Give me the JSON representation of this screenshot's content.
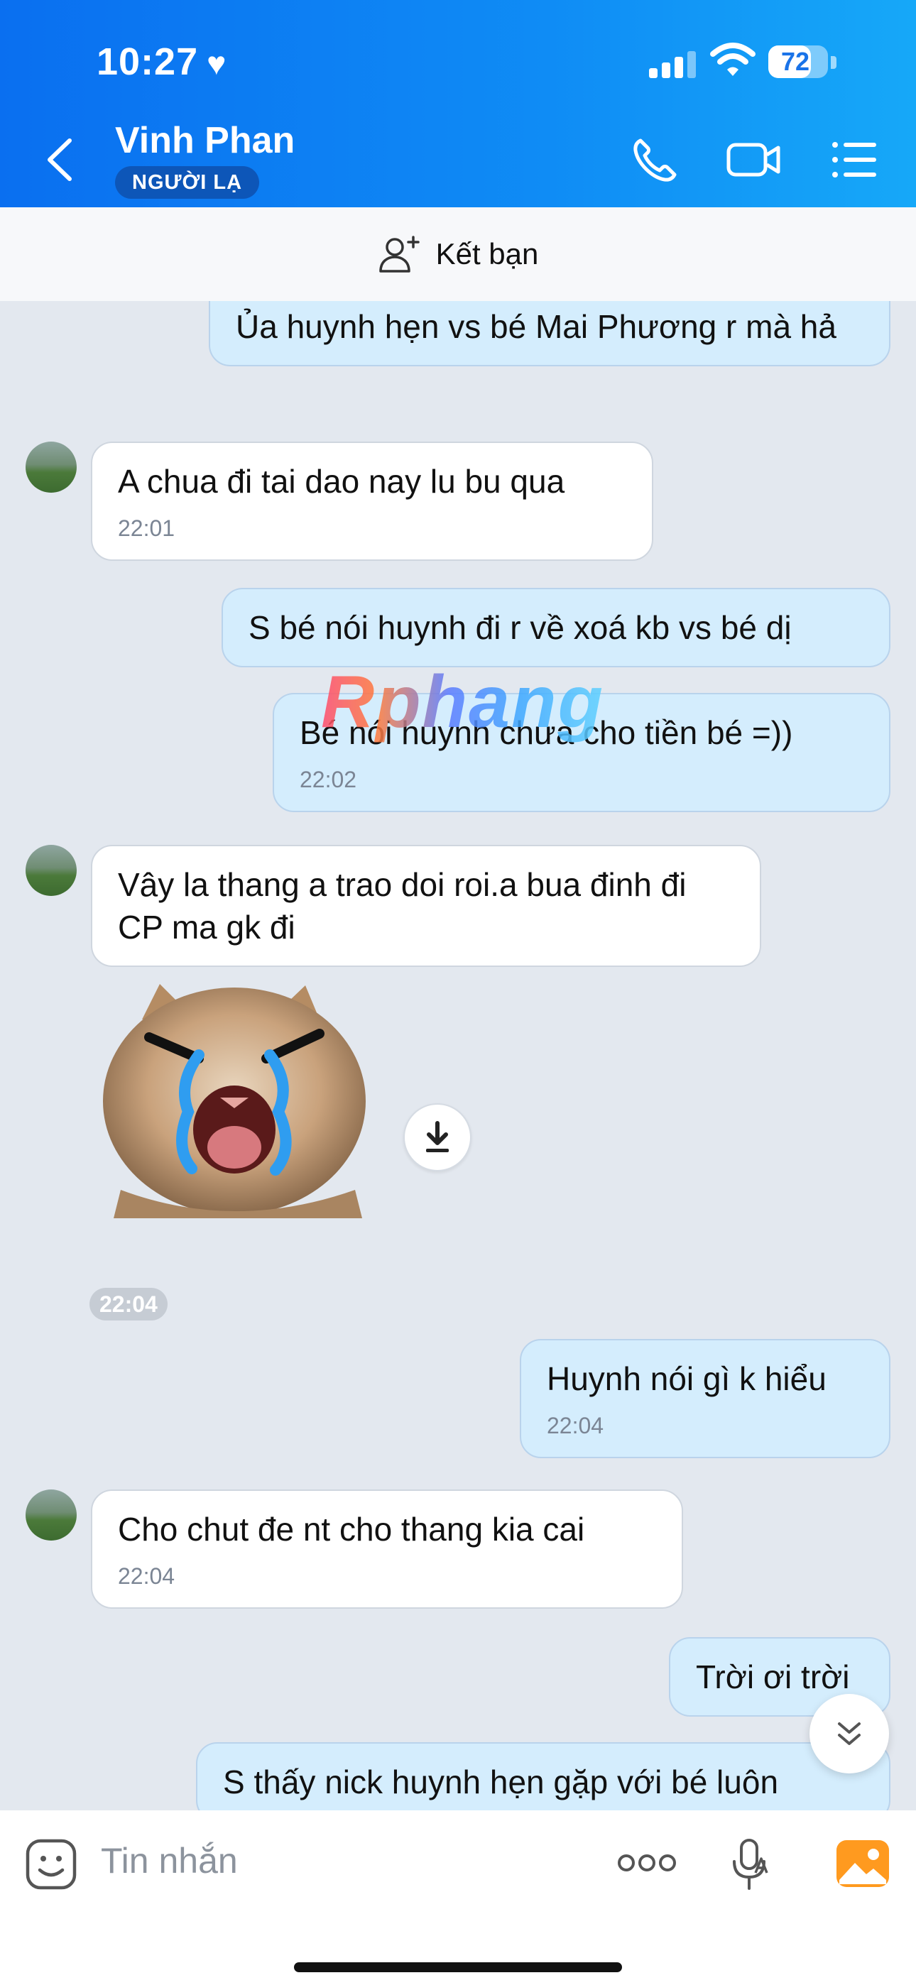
{
  "status_bar": {
    "time": "10:27",
    "battery": "72",
    "battery_level": 0.72
  },
  "header": {
    "contact_name": "Vinh Phan",
    "badge": "NGƯỜI LẠ",
    "colors": {
      "bar_start": "#0a6ff0",
      "bar_end": "#16a8f8"
    }
  },
  "add_friend": {
    "label": "Kết bạn"
  },
  "messages": [
    {
      "side": "out",
      "text": "Ủa huynh hẹn vs bé Mai Phương r mà hả",
      "time": ""
    },
    {
      "side": "in",
      "text": "A chua đi tai dao nay lu bu qua",
      "time": "22:01"
    },
    {
      "side": "out",
      "text": "S bé nói huynh đi r về xoá kb vs bé dị",
      "time": ""
    },
    {
      "side": "out",
      "text": "Bé nói huynh chưa cho tiền bé =))",
      "time": "22:02"
    },
    {
      "side": "in",
      "text": "Vây la thang a trao doi roi.a bua đinh đi CP ma gk đi",
      "time": ""
    },
    {
      "side": "in",
      "type": "sticker",
      "sticker": "crying-cat-sticker",
      "time": "22:04"
    },
    {
      "side": "out",
      "text": "Huynh nói gì k hiểu",
      "time": "22:04"
    },
    {
      "side": "in",
      "text": "Cho chut đe nt cho thang kia cai",
      "time": "22:04"
    },
    {
      "side": "out",
      "text": "Trời ơi trời",
      "time": ""
    },
    {
      "side": "out",
      "text": "S thấy nick huynh hẹn gặp với bé luôn",
      "time": ""
    }
  ],
  "watermark": "Rphang",
  "composer": {
    "placeholder": "Tin nhắn"
  }
}
